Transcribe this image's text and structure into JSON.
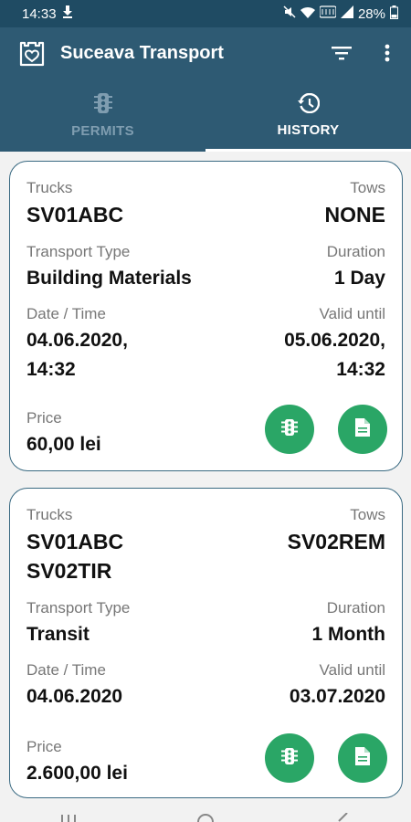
{
  "status_bar": {
    "time": "14:33",
    "battery": "28%",
    "icons": [
      "download-icon",
      "mute-icon",
      "wifi-icon",
      "volte-icon",
      "signal-icon",
      "battery-icon"
    ]
  },
  "app_bar": {
    "title": "Suceava Transport",
    "icons": [
      "castle-heart-logo-icon",
      "filter-icon",
      "more-vert-icon"
    ]
  },
  "tabs": [
    {
      "label": "PERMITS",
      "icon": "traffic-light-icon",
      "active": false
    },
    {
      "label": "HISTORY",
      "icon": "history-icon",
      "active": true
    }
  ],
  "labels": {
    "trucks": "Trucks",
    "tows": "Tows",
    "transport_type": "Transport Type",
    "duration": "Duration",
    "date_time": "Date / Time",
    "valid_until": "Valid until",
    "price": "Price"
  },
  "cards": [
    {
      "trucks": [
        "SV01ABC"
      ],
      "tows": "NONE",
      "transport_type": "Building Materials",
      "duration": "1 Day",
      "date_time": [
        "04.06.2020,",
        "14:32"
      ],
      "valid_until": [
        "05.06.2020,",
        "14:32"
      ],
      "price": "60,00 lei"
    },
    {
      "trucks": [
        "SV01ABC",
        "SV02TIR"
      ],
      "tows": "SV02REM",
      "transport_type": "Transit",
      "duration": "1 Month",
      "date_time": [
        "04.06.2020"
      ],
      "valid_until": [
        "03.07.2020"
      ],
      "price": "2.600,00 lei"
    }
  ],
  "colors": {
    "primary": "#2e5a73",
    "status_bar": "#1f4b63",
    "accent_green": "#2aa666",
    "card_border": "#3a6a82"
  }
}
